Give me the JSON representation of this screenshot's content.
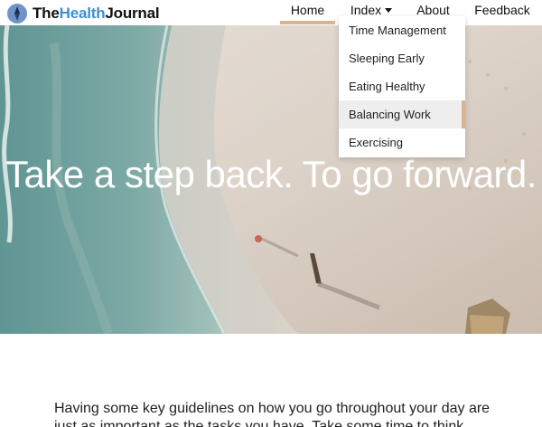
{
  "brand": {
    "part1": "The",
    "part2": "Health",
    "part3": "Journal",
    "logo_icon": "compass-logo-icon"
  },
  "nav": {
    "home": "Home",
    "index": "Index",
    "about": "About",
    "feedback": "Feedback",
    "active": "Home"
  },
  "dropdown": {
    "items": [
      {
        "label": "Time Management"
      },
      {
        "label": "Sleeping Early"
      },
      {
        "label": "Eating Healthy"
      },
      {
        "label": "Balancing Work",
        "hovered": true
      },
      {
        "label": "Exercising"
      }
    ]
  },
  "hero": {
    "title": "Take a step back. To go forward."
  },
  "intro": {
    "text": "Having some key guidelines on how you go throughout your day are just as important as the tasks you have. Take some time to think"
  },
  "colors": {
    "accent": "#d9b494",
    "brand_blue": "#3d8fd6",
    "logo_bg": "#6f93c9"
  }
}
